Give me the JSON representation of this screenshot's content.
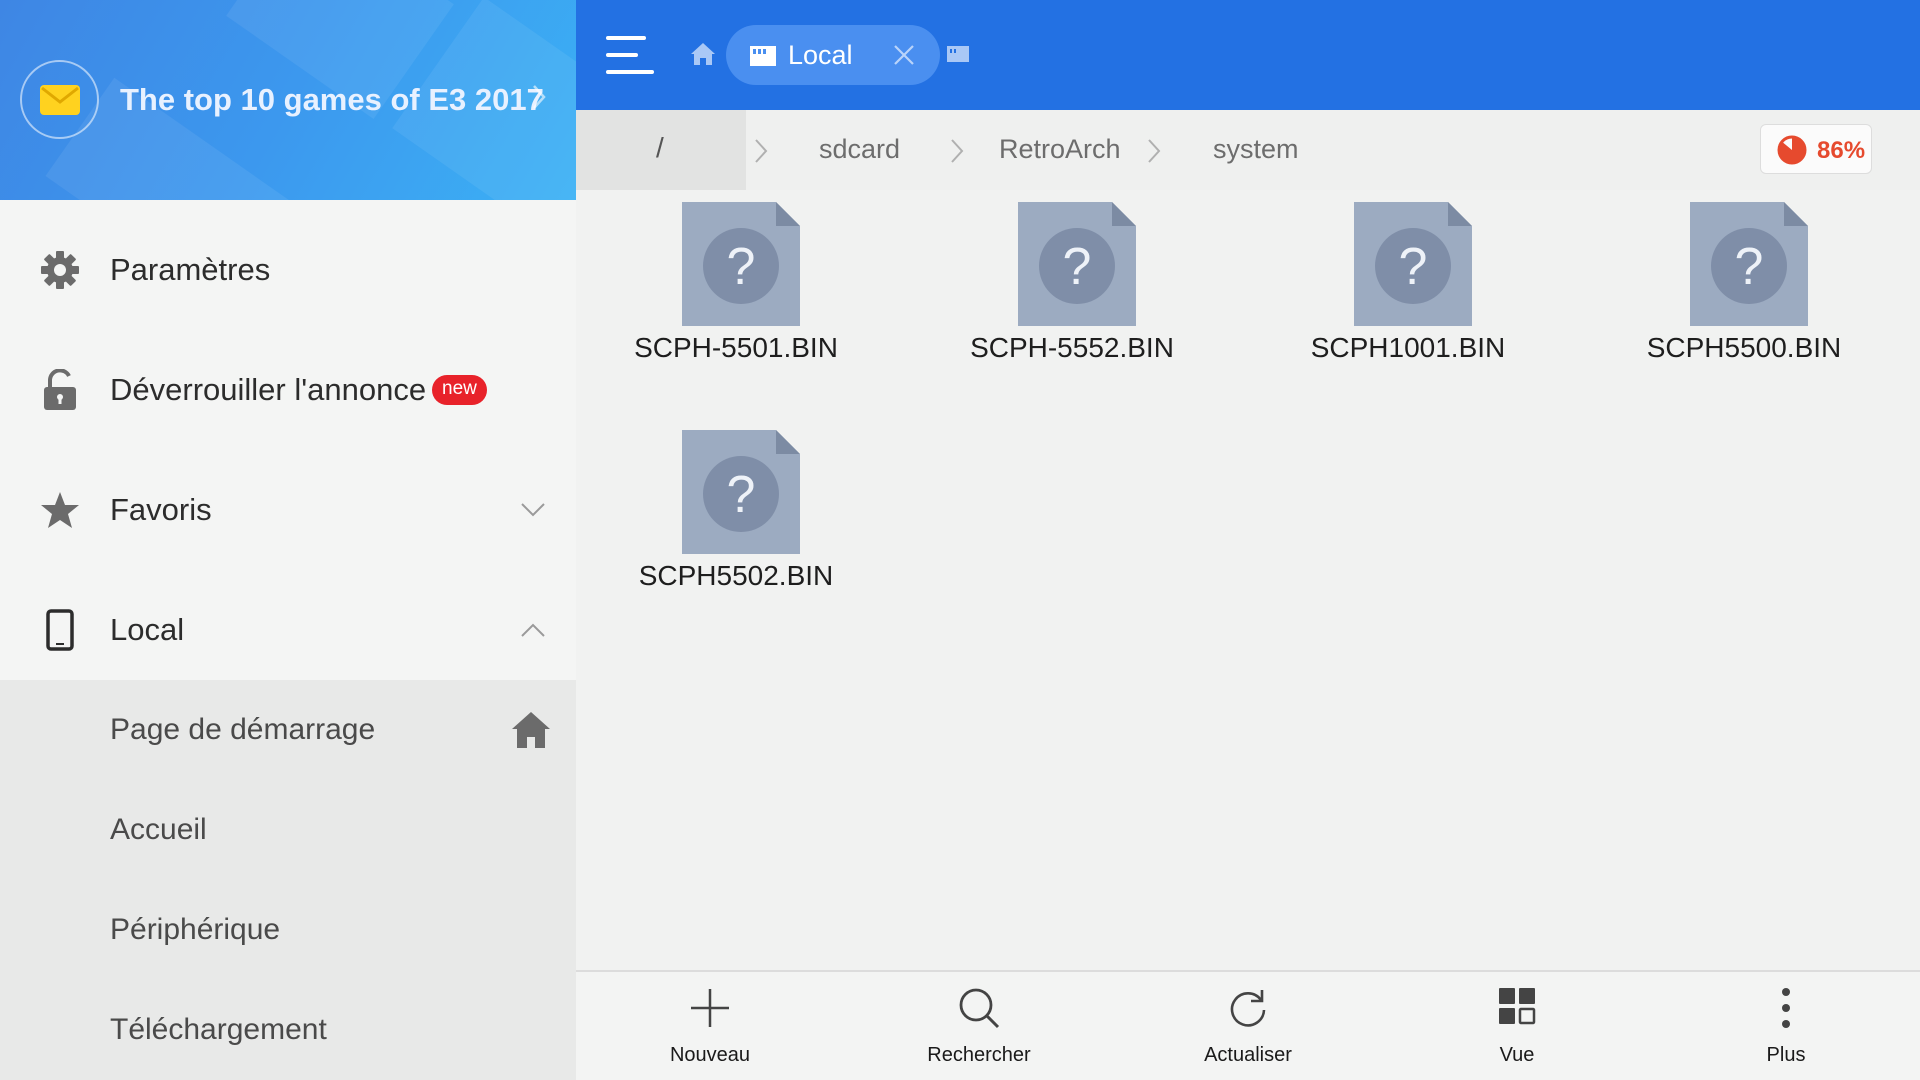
{
  "sidebar": {
    "promo": {
      "text": "The top 10 games of E3 2017",
      "icon": "mail-icon"
    },
    "items": [
      {
        "label": "Paramètres",
        "icon": "gear-icon"
      },
      {
        "label": "Déverrouiller l'annonce",
        "icon": "unlock-icon",
        "badge": "new"
      },
      {
        "label": "Favoris",
        "icon": "star-icon"
      },
      {
        "label": "Local",
        "icon": "phone-icon"
      }
    ],
    "local_sub": [
      {
        "label": "Page de démarrage",
        "icon": "home-icon"
      },
      {
        "label": "Accueil"
      },
      {
        "label": "Périphérique"
      },
      {
        "label": "Téléchargement"
      }
    ]
  },
  "topbar": {
    "tab_label": "Local"
  },
  "breadcrumb": {
    "root": "/",
    "parts": [
      "sdcard",
      "RetroArch",
      "system"
    ]
  },
  "storage": {
    "percent_label": "86%",
    "used_fraction": 0.86
  },
  "files": [
    {
      "name": "SCPH-5501.BIN"
    },
    {
      "name": "SCPH-5552.BIN"
    },
    {
      "name": "SCPH1001.BIN"
    },
    {
      "name": "SCPH5500.BIN"
    },
    {
      "name": "SCPH5502.BIN"
    }
  ],
  "bottom_bar": [
    {
      "label": "Nouveau",
      "icon": "plus-icon"
    },
    {
      "label": "Rechercher",
      "icon": "search-icon"
    },
    {
      "label": "Actualiser",
      "icon": "refresh-icon"
    },
    {
      "label": "Vue",
      "icon": "grid-view-icon"
    },
    {
      "label": "Plus",
      "icon": "more-vertical-icon"
    }
  ],
  "colors": {
    "topbar": "#2371e3",
    "tab": "#4a8ff0",
    "badge_new": "#e8222a",
    "storage_text": "#e64a2e",
    "file_icon": "#9cabc1"
  }
}
